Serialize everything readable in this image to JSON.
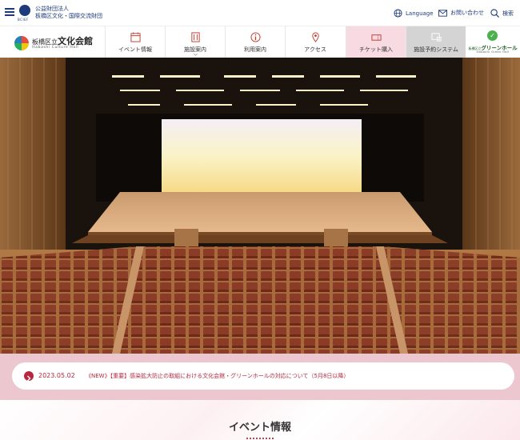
{
  "header": {
    "foundation_logo_text": "BCIEF",
    "foundation_line1": "公益財団法人",
    "foundation_line2": "板橋区文化・国際交流財団",
    "language_label": "Language",
    "contact_label": "お問い合わせ",
    "search_label": "検索"
  },
  "site": {
    "name_main": "板橋区立",
    "name_hall": "文化会館",
    "name_en": "Itabashi Culture Hall"
  },
  "nav": {
    "items": [
      {
        "label": "イベント情報",
        "icon": "calendar-icon"
      },
      {
        "label": "施設案内",
        "icon": "building-icon"
      },
      {
        "label": "利用案内",
        "icon": "info-icon"
      },
      {
        "label": "アクセス",
        "icon": "map-pin-icon"
      },
      {
        "label": "チケット購入",
        "icon": "ticket-icon"
      },
      {
        "label": "施設予約システム",
        "icon": "booking-icon"
      }
    ],
    "green_hall_prefix": "板橋区立",
    "green_hall_jp": "グリーンホール",
    "green_hall_en": "Itabashi Green Hall"
  },
  "news": {
    "date": "2023.05.02",
    "text": "《NEW》【重要】感染拡大防止の取組における文化会館・グリーンホールの対応について（5月8日以降）"
  },
  "events": {
    "title": "イベント情報"
  },
  "colors": {
    "brand_navy": "#1d3a7a",
    "accent_red": "#b5283f",
    "news_bg": "#ecc7d0",
    "ticket_bg": "#f8dbe2",
    "booking_bg": "#d4d4d4"
  }
}
